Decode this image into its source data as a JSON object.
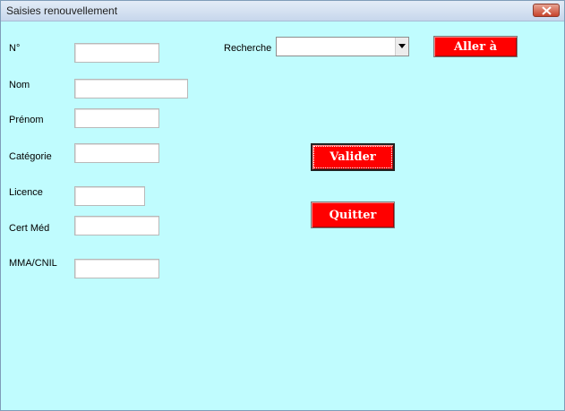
{
  "window": {
    "title": "Saisies renouvellement"
  },
  "form": {
    "numero_label": "N°",
    "nom_label": "Nom",
    "prenom_label": "Prénom",
    "categorie_label": "Catégorie",
    "licence_label": "Licence",
    "certmed_label": "Cert Méd",
    "mma_label": "MMA/CNIL"
  },
  "search": {
    "label": "Recherche",
    "value": ""
  },
  "buttons": {
    "goto": "Aller à",
    "validate": "Valider",
    "quit": "Quitter"
  },
  "colors": {
    "background": "#c0fcfe",
    "button": "#ff0000"
  }
}
